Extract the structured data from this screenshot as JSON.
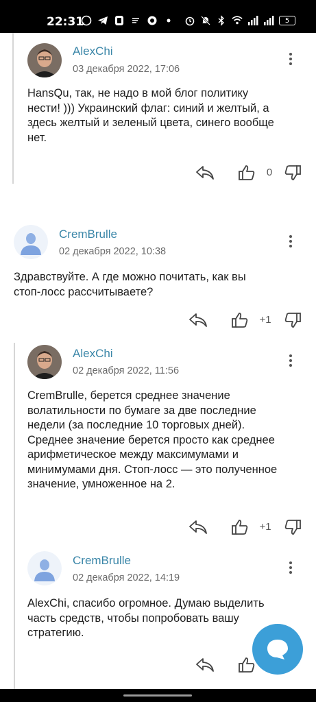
{
  "status_bar": {
    "time": "22:31",
    "battery": "5",
    "left_icons": [
      "whatsapp-icon",
      "telegram-icon",
      "app-icon",
      "notes-icon",
      "browser-icon",
      "dot-icon"
    ],
    "right_icons": [
      "alarm-icon",
      "mute-icon",
      "bluetooth-icon",
      "wifi-icon",
      "signal-icon",
      "signal-icon"
    ]
  },
  "comments": [
    {
      "author": "AlexChi",
      "date": "03 декабря 2022, 17:06",
      "lines": [
        "HansQu, так, не надо в мой блог политику",
        "нести! ))) Украинский флаг: синий и желтый, а",
        "здесь желтый и зеленый цвета, синего вообще",
        "нет."
      ],
      "score": "0",
      "avatar": "photo"
    },
    {
      "author": "CremBrulle",
      "date": "02 декабря 2022, 10:38",
      "lines": [
        "Здравствуйте. А где можно почитать, как вы",
        "стоп-лосс рассчитываете?"
      ],
      "score": "+1",
      "avatar": "default"
    },
    {
      "author": "AlexChi",
      "date": "02 декабря 2022, 11:56",
      "lines": [
        "CremBrulle, берется среднее значение",
        "волатильности по бумаге за две последние",
        "недели (за последние 10 торговых дней).",
        "Среднее значение берется просто как среднее",
        "арифметическое между максимумами и",
        "минимумами дня. Стоп-лосс — это полученное",
        "значение, умноженное на 2."
      ],
      "score": "+1",
      "avatar": "photo"
    },
    {
      "author": "CremBrulle",
      "date": "02 декабря 2022, 14:19",
      "lines": [
        "AlexChi, спасибо огромное. Думаю выделить",
        "часть средств, чтобы попробовать вашу",
        "стратегию."
      ],
      "score": "",
      "avatar": "default"
    }
  ],
  "colors": {
    "author": "#3a86a8",
    "fab": "#3c9fd8",
    "thread_line": "#d6d6d6"
  }
}
